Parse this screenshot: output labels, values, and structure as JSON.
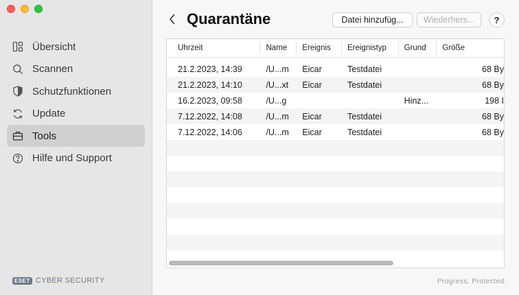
{
  "sidebar": {
    "items": [
      {
        "label": "Übersicht",
        "icon": "dashboard-icon"
      },
      {
        "label": "Scannen",
        "icon": "search-icon"
      },
      {
        "label": "Schutzfunktionen",
        "icon": "shield-icon"
      },
      {
        "label": "Update",
        "icon": "refresh-icon"
      },
      {
        "label": "Tools",
        "icon": "toolbox-icon",
        "active": true
      },
      {
        "label": "Hilfe und Support",
        "icon": "help-icon"
      }
    ],
    "brand_logo": "ESET",
    "brand_text": "CYBER SECURITY"
  },
  "header": {
    "title": "Quarantäne",
    "add_button": "Datei hinzufüg...",
    "restore_button": "Wiederhers...",
    "help_button": "?"
  },
  "table": {
    "columns": [
      "Uhrzeit",
      "Name",
      "Ereignis",
      "Ereignistyp",
      "Grund",
      "Größe"
    ],
    "rows": [
      [
        "21.2.2023, 14:39",
        "/U...m",
        "Eicar",
        "Testdatei",
        "",
        "68 By"
      ],
      [
        "21.2.2023, 14:10",
        "/U...xt",
        "Eicar",
        "Testdatei",
        "",
        "68 By"
      ],
      [
        "16.2.2023, 09:58",
        "/U...g",
        "",
        "",
        "Hinz...",
        "198 I"
      ],
      [
        "7.12.2022, 14:08",
        "/U...m",
        "Eicar",
        "Testdatei",
        "",
        "68 By"
      ],
      [
        "7.12.2022, 14:06",
        "/U...m",
        "Eicar",
        "Testdatei",
        "",
        "68 By"
      ]
    ]
  },
  "footer": {
    "tagline": "Progress. Protected."
  },
  "colors": {
    "sidebar_bg": "#e6e6e6",
    "active_item_bg": "#d0d0d0",
    "main_bg": "#f7f7f7",
    "alt_row_bg": "#f4f4f4"
  }
}
